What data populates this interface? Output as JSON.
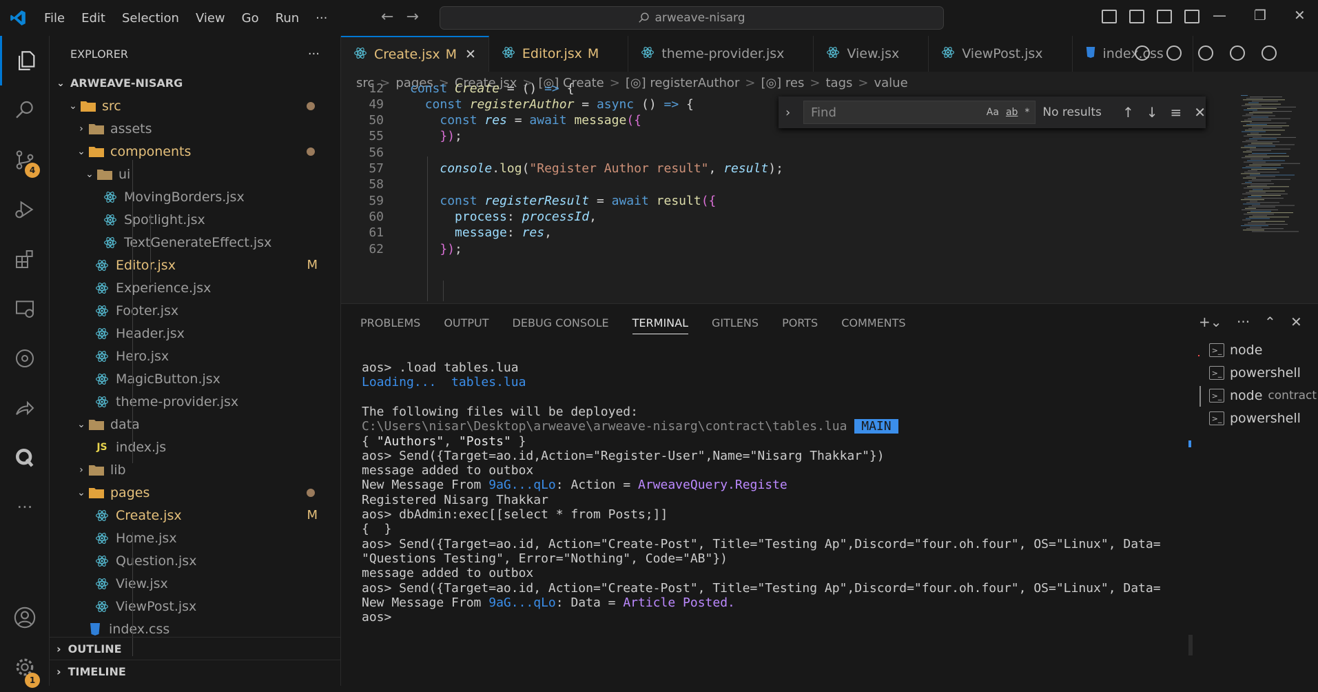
{
  "menu": [
    "File",
    "Edit",
    "Selection",
    "View",
    "Go",
    "Run",
    "···"
  ],
  "command_center": "arweave-nisarg",
  "activity_badges": {
    "source_control": "4",
    "settings": "1"
  },
  "explorer": {
    "title": "EXPLORER",
    "more": "···",
    "root": "ARWEAVE-NISARG",
    "items": [
      {
        "label": "src",
        "depth": 1,
        "type": "folder-open",
        "color": "#e5c07b",
        "status": "dot"
      },
      {
        "label": "assets",
        "depth": 2,
        "type": "folder",
        "color": "#9d9d9d",
        "status": ""
      },
      {
        "label": "components",
        "depth": 2,
        "type": "folder-open",
        "color": "#e5c07b",
        "status": "dot"
      },
      {
        "label": "ui",
        "depth": 3,
        "type": "folder-open",
        "color": "#9d9d9d",
        "status": ""
      },
      {
        "label": "MovingBorders.jsx",
        "depth": 4,
        "type": "react",
        "color": "#9d9d9d",
        "status": ""
      },
      {
        "label": "Spotlight.jsx",
        "depth": 4,
        "type": "react",
        "color": "#9d9d9d",
        "status": ""
      },
      {
        "label": "TextGenerateEffect.jsx",
        "depth": 4,
        "type": "react",
        "color": "#9d9d9d",
        "status": ""
      },
      {
        "label": "Editor.jsx",
        "depth": 3,
        "type": "react",
        "color": "#e5c07b",
        "status": "M"
      },
      {
        "label": "Experience.jsx",
        "depth": 3,
        "type": "react",
        "color": "#9d9d9d",
        "status": ""
      },
      {
        "label": "Footer.jsx",
        "depth": 3,
        "type": "react",
        "color": "#9d9d9d",
        "status": ""
      },
      {
        "label": "Header.jsx",
        "depth": 3,
        "type": "react",
        "color": "#9d9d9d",
        "status": ""
      },
      {
        "label": "Hero.jsx",
        "depth": 3,
        "type": "react",
        "color": "#9d9d9d",
        "status": ""
      },
      {
        "label": "MagicButton.jsx",
        "depth": 3,
        "type": "react",
        "color": "#9d9d9d",
        "status": ""
      },
      {
        "label": "theme-provider.jsx",
        "depth": 3,
        "type": "react",
        "color": "#9d9d9d",
        "status": ""
      },
      {
        "label": "data",
        "depth": 2,
        "type": "folder-open",
        "color": "#9d9d9d",
        "status": ""
      },
      {
        "label": "index.js",
        "depth": 3,
        "type": "js",
        "color": "#9d9d9d",
        "status": ""
      },
      {
        "label": "lib",
        "depth": 2,
        "type": "folder",
        "color": "#9d9d9d",
        "status": ""
      },
      {
        "label": "pages",
        "depth": 2,
        "type": "folder-open",
        "color": "#e5c07b",
        "status": "dot"
      },
      {
        "label": "Create.jsx",
        "depth": 3,
        "type": "react",
        "color": "#e5c07b",
        "status": "M"
      },
      {
        "label": "Home.jsx",
        "depth": 3,
        "type": "react",
        "color": "#9d9d9d",
        "status": ""
      },
      {
        "label": "Question.jsx",
        "depth": 3,
        "type": "react",
        "color": "#9d9d9d",
        "status": ""
      },
      {
        "label": "View.jsx",
        "depth": 3,
        "type": "react",
        "color": "#9d9d9d",
        "status": ""
      },
      {
        "label": "ViewPost.jsx",
        "depth": 3,
        "type": "react",
        "color": "#9d9d9d",
        "status": ""
      },
      {
        "label": "index.css",
        "depth": 2,
        "type": "css",
        "color": "#9d9d9d",
        "status": ""
      }
    ],
    "outline": "OUTLINE",
    "timeline": "TIMELINE"
  },
  "tabs": [
    {
      "label": "Create.jsx",
      "mod": "M",
      "active": true
    },
    {
      "label": "Editor.jsx",
      "mod": "M",
      "active": false
    },
    {
      "label": "theme-provider.jsx",
      "mod": "",
      "active": false
    },
    {
      "label": "View.jsx",
      "mod": "",
      "active": false
    },
    {
      "label": "ViewPost.jsx",
      "mod": "",
      "active": false
    },
    {
      "label": "index.css",
      "mod": "",
      "active": false
    }
  ],
  "breadcrumb": [
    "src",
    ">",
    "pages",
    ">",
    "Create.jsx",
    ">",
    "[◎] Create",
    ">",
    "[◎] registerAuthor",
    ">",
    "[◎] res",
    ">",
    "tags",
    ">",
    "value"
  ],
  "code_lines": [
    {
      "n": "12",
      "html": "<span class='kw'>const</span> <span class='fn it'>Create</span> = () <span class='kw'>=&gt;</span> {"
    },
    {
      "n": "49",
      "html": "  <span class='kw'>const</span> <span class='fn it'>registerAuthor</span> = <span class='kw'>async</span> () <span class='kw'>=&gt;</span> {"
    },
    {
      "n": "50",
      "html": "    <span class='kw'>const</span> <span class='var it'>res</span> = <span class='kw'>await</span> <span class='fn'>message</span><span class='pn'>({</span>"
    },
    {
      "n": "55",
      "html": "    <span class='pn'>})</span>;"
    },
    {
      "n": "56",
      "html": ""
    },
    {
      "n": "57",
      "html": "    <span class='var it'>console</span>.<span class='fn'>log</span>(<span class='str'>\"Register Author result\"</span>, <span class='var it'>result</span>);"
    },
    {
      "n": "58",
      "html": ""
    },
    {
      "n": "59",
      "html": "    <span class='kw'>const</span> <span class='var it'>registerResult</span> = <span class='kw'>await</span> <span class='fn'>result</span><span class='pn'>({</span>"
    },
    {
      "n": "60",
      "html": "      <span class='var'>process</span>: <span class='var it'>processId</span>,"
    },
    {
      "n": "61",
      "html": "      <span class='var'>message</span>: <span class='var it'>res</span>,"
    },
    {
      "n": "62",
      "html": "    <span class='pn'>})</span>;"
    }
  ],
  "find": {
    "placeholder": "Find",
    "options": [
      "Aa",
      "ab",
      "*"
    ],
    "result": "No results"
  },
  "panel_tabs": [
    "PROBLEMS",
    "OUTPUT",
    "DEBUG CONSOLE",
    "TERMINAL",
    "GITLENS",
    "PORTS",
    "COMMENTS"
  ],
  "terminal_lines": [
    "aos> .load tables.lua",
    "<span class='cy'>Loading...  tables.lua</span>",
    "",
    "The following files will be deployed:",
    "<span class='gy'>C:\\Users\\nisar\\Desktop\\arweave\\arweave-nisarg\\contract\\tables.lua</span> <span class='hl'>MAIN</span>",
    "{ <span style='color:#e5e5e5'>\"Authors\"</span>, <span style='color:#e5e5e5'>\"Posts\"</span> }",
    "aos> Send({Target=ao.id,Action=\"Register-User\",Name=\"Nisarg Thakkar\"})",
    "message added to outbox",
    "New Message From <span class='cy'>9aG...qLo</span>: Action = <span class='mg'>ArweaveQuery.Registe</span>",
    "Registered Nisarg Thakkar",
    "aos> dbAdmin:exec[[select * from Posts;]]",
    "{  }",
    "aos> Send({Target=ao.id, Action=\"Create-Post\", Title=\"Testing Ap\",Discord=\"four.oh.four\", OS=\"Linux\", Data=",
    "\"Questions Testing\", Error=\"Nothing\", Code=\"AB\"})",
    "message added to outbox",
    "aos> Send({Target=ao.id, Action=\"Create-Post\", Title=\"Testing Ap\",Discord=\"four.oh.four\", OS=\"Linux\", Data=",
    "New Message From <span class='cy'>9aG...qLo</span>: Data = <span class='mg'>Article Posted.</span>",
    "aos> "
  ],
  "terminals": [
    {
      "name": "node",
      "extra": ""
    },
    {
      "name": "powershell",
      "extra": ""
    },
    {
      "name": "node",
      "extra": "contract"
    },
    {
      "name": "powershell",
      "extra": ""
    }
  ]
}
